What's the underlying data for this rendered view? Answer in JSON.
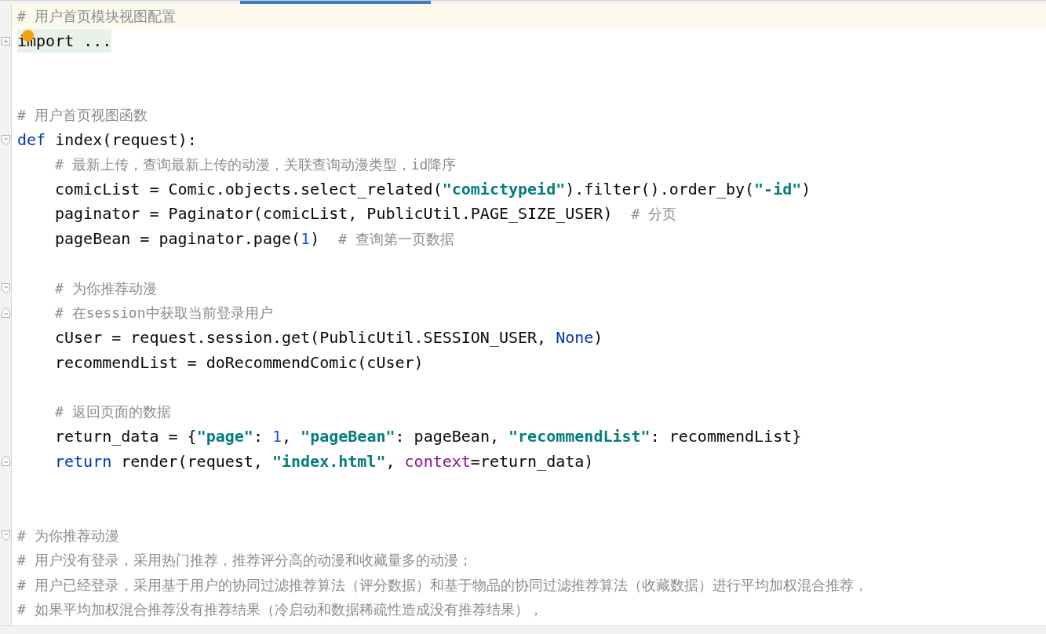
{
  "editor": {
    "lines": [
      {
        "current": true,
        "tokens": [
          {
            "kind": "comment",
            "text": "# 用户首页模块视图配置"
          }
        ]
      },
      {
        "current": false,
        "collapsed": true,
        "marker": true,
        "tokens": [
          {
            "kind": "plain",
            "text": "import ..."
          }
        ]
      },
      {
        "current": false
      },
      {
        "current": false
      },
      {
        "current": false,
        "tokens": [
          {
            "kind": "comment",
            "text": "# 用户首页视图函数"
          }
        ]
      },
      {
        "current": false,
        "fold_start": true,
        "tokens": [
          {
            "kind": "keyword",
            "text": "def"
          },
          {
            "kind": "plain",
            "text": " index(request):"
          }
        ]
      },
      {
        "current": false,
        "indented": true,
        "tokens": [
          {
            "kind": "comment",
            "text": "# 最新上传，查询最新上传的动漫，关联查询动漫类型，id降序"
          }
        ]
      },
      {
        "current": false,
        "indented": true,
        "tokens": [
          {
            "kind": "plain",
            "text": "comicList = Comic.objects.select_related("
          },
          {
            "kind": "string",
            "text": "\"comictypeid\""
          },
          {
            "kind": "plain",
            "text": ").filter().order_by("
          },
          {
            "kind": "string",
            "text": "\"-id\""
          },
          {
            "kind": "plain",
            "text": ")"
          }
        ]
      },
      {
        "current": false,
        "indented": true,
        "tokens": [
          {
            "kind": "plain",
            "text": "paginator = Paginator(comicList, PublicUtil.PAGE_SIZE_USER)  "
          },
          {
            "kind": "comment",
            "text": "# 分页"
          }
        ]
      },
      {
        "current": false,
        "indented": true,
        "tokens": [
          {
            "kind": "plain",
            "text": "pageBean = paginator.page("
          },
          {
            "kind": "number",
            "text": "1"
          },
          {
            "kind": "plain",
            "text": ")  "
          },
          {
            "kind": "comment",
            "text": "# 查询第一页数据"
          }
        ]
      },
      {
        "current": false
      },
      {
        "current": false,
        "indented": true,
        "fold_start": true,
        "tokens": [
          {
            "kind": "comment",
            "text": "# 为你推荐动漫"
          }
        ]
      },
      {
        "current": false,
        "indented": true,
        "fold_end": true,
        "tokens": [
          {
            "kind": "comment",
            "text": "# 在session中获取当前登录用户"
          }
        ]
      },
      {
        "current": false,
        "indented": true,
        "tokens": [
          {
            "kind": "plain",
            "text": "cUser = request.session.get(PublicUtil.SESSION_USER, "
          },
          {
            "kind": "keyword",
            "text": "None"
          },
          {
            "kind": "plain",
            "text": ")"
          }
        ]
      },
      {
        "current": false,
        "indented": true,
        "tokens": [
          {
            "kind": "plain",
            "text": "recommendList = doRecommendComic(cUser)"
          }
        ]
      },
      {
        "current": false
      },
      {
        "current": false,
        "indented": true,
        "tokens": [
          {
            "kind": "comment",
            "text": "# 返回页面的数据"
          }
        ]
      },
      {
        "current": false,
        "indented": true,
        "tokens": [
          {
            "kind": "plain",
            "text": "return_data = {"
          },
          {
            "kind": "string",
            "text": "\"page\""
          },
          {
            "kind": "plain",
            "text": ": "
          },
          {
            "kind": "number",
            "text": "1"
          },
          {
            "kind": "plain",
            "text": ", "
          },
          {
            "kind": "string",
            "text": "\"pageBean\""
          },
          {
            "kind": "plain",
            "text": ": pageBean, "
          },
          {
            "kind": "string",
            "text": "\"recommendList\""
          },
          {
            "kind": "plain",
            "text": ": recommendList}"
          }
        ]
      },
      {
        "current": false,
        "indented": true,
        "fold_end": true,
        "tokens": [
          {
            "kind": "keyword",
            "text": "return"
          },
          {
            "kind": "plain",
            "text": " render(request, "
          },
          {
            "kind": "string",
            "text": "\"index.html\""
          },
          {
            "kind": "plain",
            "text": ", "
          },
          {
            "kind": "param",
            "text": "context"
          },
          {
            "kind": "plain",
            "text": "=return_data)"
          }
        ]
      },
      {
        "current": false
      },
      {
        "current": false
      },
      {
        "current": false,
        "fold_start": true,
        "tokens": [
          {
            "kind": "comment",
            "text": "# 为你推荐动漫"
          }
        ]
      },
      {
        "current": false,
        "tokens": [
          {
            "kind": "comment",
            "text": "# 用户没有登录，采用热门推荐，推荐评分高的动漫和收藏量多的动漫；"
          }
        ]
      },
      {
        "current": false,
        "tokens": [
          {
            "kind": "comment",
            "text": "# 用户已经登录，采用基于用户的协同过滤推荐算法（评分数据）和基于物品的协同过滤推荐算法（收藏数据）进行平均加权混合推荐，"
          }
        ]
      },
      {
        "current": false,
        "tokens": [
          {
            "kind": "comment",
            "text": "# 如果平均加权混合推荐没有推荐结果（冷启动和数据稀疏性造成没有推荐结果），"
          }
        ]
      }
    ]
  }
}
